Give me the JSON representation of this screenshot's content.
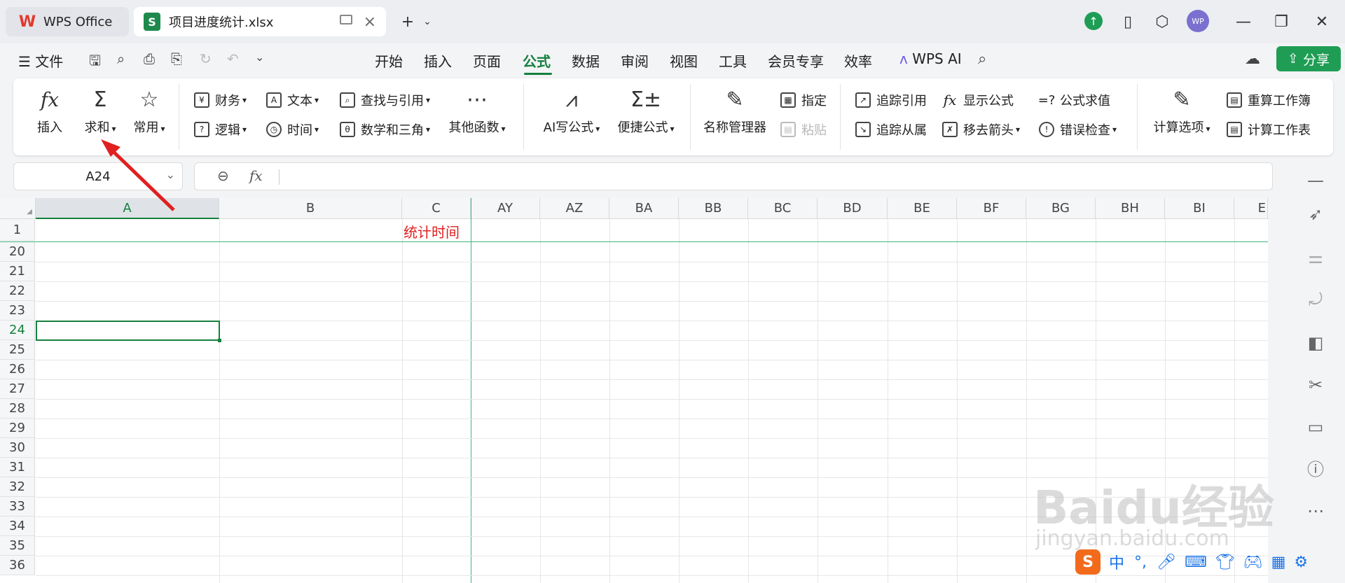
{
  "titlebar": {
    "home_tab": "WPS Office",
    "file_tab": "项目进度统计.xlsx",
    "file_badge": "S",
    "avatar": "WP",
    "icons": [
      "upload-icon",
      "tablet-icon",
      "cube-icon",
      "minimize-icon",
      "restore-icon",
      "close-icon"
    ]
  },
  "menubar": {
    "file_label": "文件",
    "tabs": [
      "开始",
      "插入",
      "页面",
      "公式",
      "数据",
      "审阅",
      "视图",
      "工具",
      "会员专享",
      "效率"
    ],
    "active_tab": "公式",
    "ai_label": "WPS AI",
    "share_label": "分享"
  },
  "ribbon": {
    "insert_fn": "插入",
    "sum": "求和",
    "common": "常用",
    "finance": "财务",
    "text": "文本",
    "lookup": "查找与引用",
    "logic": "逻辑",
    "time": "时间",
    "math": "数学和三角",
    "other": "其他函数",
    "ai_formula": "AI写公式",
    "quick_formula": "便捷公式",
    "name_manager": "名称管理器",
    "assign": "指定",
    "paste": "粘贴",
    "trace_precedents": "追踪引用",
    "trace_dependents": "追踪从属",
    "show_formulas": "显示公式",
    "remove_arrows": "移去箭头",
    "evaluate": "公式求值",
    "error_check": "错误检查",
    "calc_options": "计算选项",
    "recalc_workbook": "重算工作簿",
    "calc_sheet": "计算工作表"
  },
  "formula_bar": {
    "cell_ref": "A24",
    "fx": "fx",
    "value": ""
  },
  "sheet": {
    "columns": [
      "A",
      "B",
      "C",
      "AY",
      "AZ",
      "BA",
      "BB",
      "BC",
      "BD",
      "BE",
      "BF",
      "BG",
      "BH",
      "BI",
      "E"
    ],
    "rows": [
      "1",
      "20",
      "21",
      "22",
      "23",
      "24",
      "25",
      "26",
      "27",
      "28",
      "29",
      "30",
      "31",
      "32",
      "33",
      "34",
      "35",
      "36"
    ],
    "selected_cell": "A24",
    "c1_text": "统计时间",
    "c1_color": "#e02020"
  },
  "watermark": {
    "main": "Baidu经验",
    "sub": "jingyan.baidu.com"
  },
  "ime": {
    "lang": "中",
    "punct": "°,"
  },
  "colors": {
    "accent": "#15803d",
    "share": "#1f9d55",
    "arrow": "#e02020"
  }
}
